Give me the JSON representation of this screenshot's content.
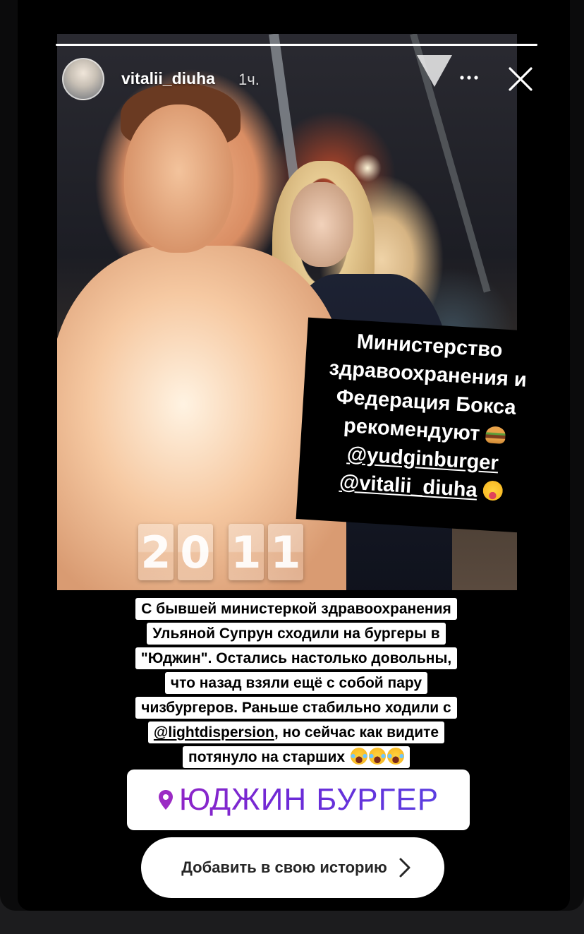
{
  "story": {
    "username": "vitalii_diuha",
    "time": "1ч.",
    "progress": 1.0,
    "icons": {
      "more": "more-dots-icon",
      "close": "close-icon"
    }
  },
  "date_sticker": {
    "digits": [
      "2",
      "0",
      "1",
      "1"
    ]
  },
  "overlay": {
    "line1": "Министерство",
    "line2": "здравоохранения и",
    "line3": "Федерация Бокса",
    "line4": "рекомендуют",
    "mention1": "@yudginburger",
    "mention2": "@vitalii_diuha",
    "emoji1": "burger-emoji",
    "emoji2": "winking-tongue-emoji"
  },
  "caption": {
    "line1": "С бывшей министеркой здравоохранения",
    "line2": "Ульяной Супрун сходили на бургеры в",
    "line3": "\"Юджин\". Остались настолько довольны,",
    "line4": "что назад взяли ещё с собой пару",
    "line5": "чизбургеров. Раньше стабильно ходили с",
    "line6_mention": "@lightdispersion",
    "line6_rest": ", но сейчас как видите",
    "line7": "потянуло на старших"
  },
  "location": {
    "label": "ЮДЖИН БУРГЕР",
    "icon": "location-pin-icon",
    "color": "#8e24c8"
  },
  "cta": {
    "label": "Добавить в свою историю",
    "icon": "chevron-right-icon"
  }
}
